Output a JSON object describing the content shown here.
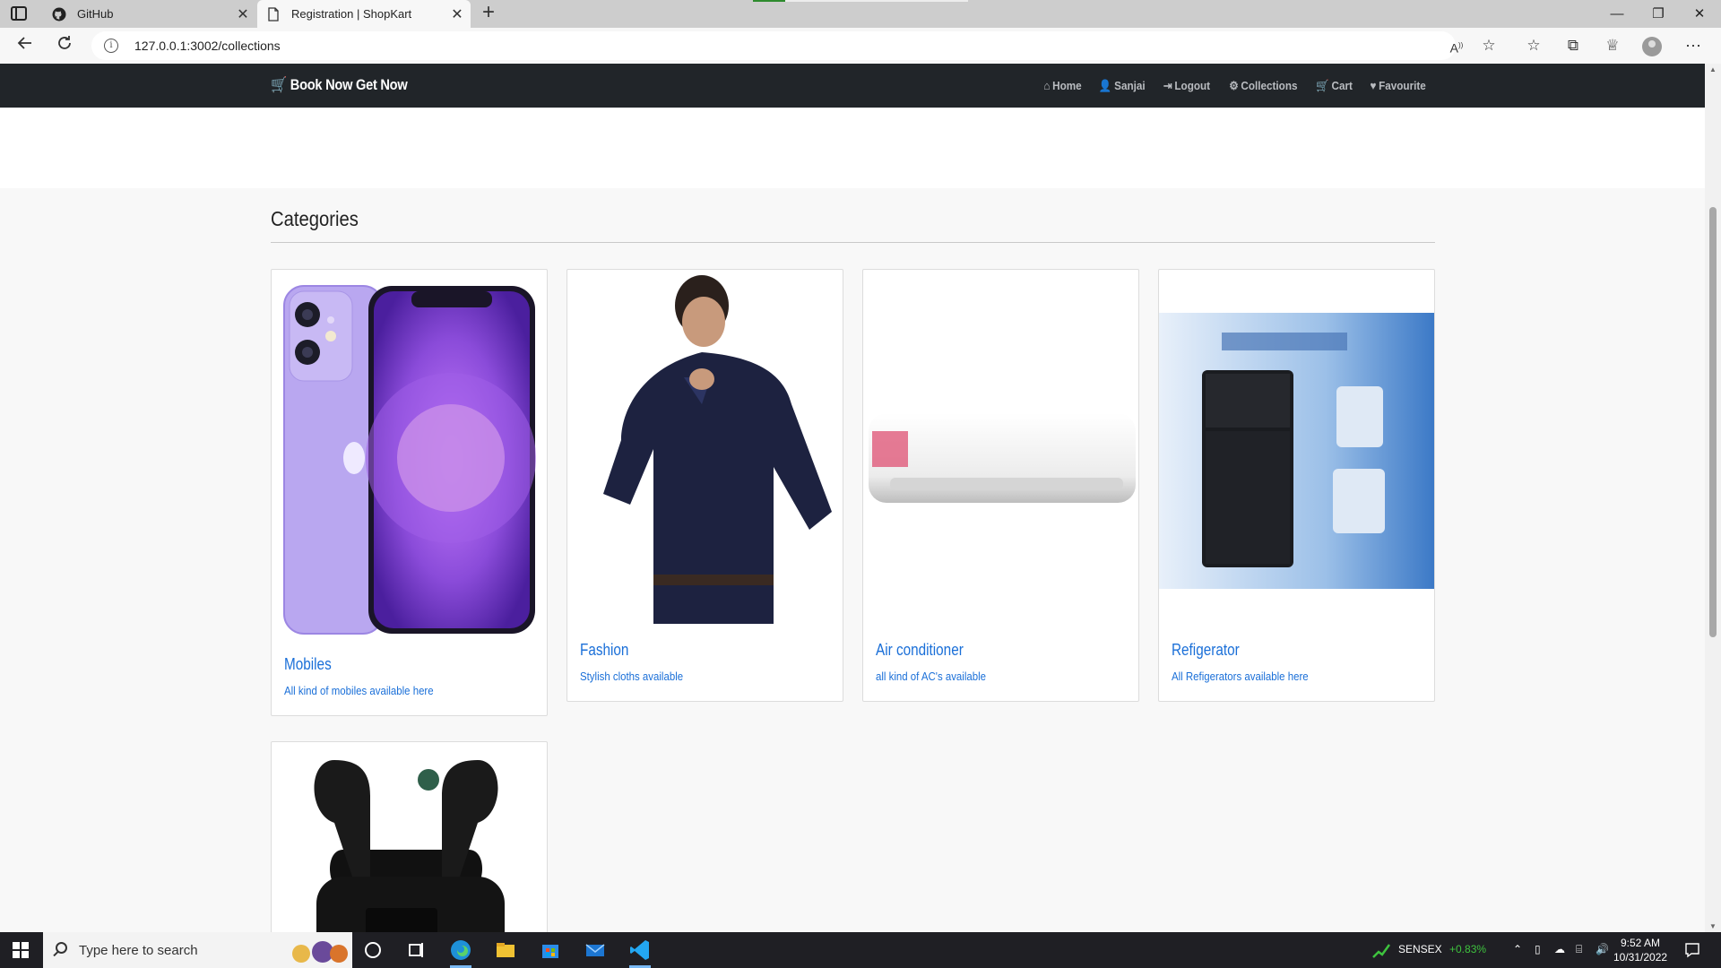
{
  "browser": {
    "tabs": [
      {
        "label": "GitHub",
        "close": "✕"
      },
      {
        "label": "Registration | ShopKart",
        "close": "✕"
      }
    ],
    "new_tab": "+",
    "url": "127.0.0.1:3002/collections",
    "window_controls": [
      "—",
      "❐",
      "✕"
    ],
    "load_progress": 0.15
  },
  "site": {
    "brand": "Book Now Get Now",
    "nav": [
      {
        "icon": "⌂",
        "label": "Home"
      },
      {
        "icon": "👤",
        "label": "Sanjai"
      },
      {
        "icon": "⇥",
        "label": "Logout"
      },
      {
        "icon": "⚙",
        "label": "Collections"
      },
      {
        "icon": "🛒",
        "label": "Cart"
      },
      {
        "icon": "♥",
        "label": "Favourite"
      }
    ],
    "section_title": "Categories",
    "categories": [
      {
        "title": "Mobiles",
        "description": "All kind of mobiles available here"
      },
      {
        "title": "Fashion",
        "description": "Stylish cloths available"
      },
      {
        "title": "Air conditioner",
        "description": "all kind of AC's available"
      },
      {
        "title": "Refigerator",
        "description": "All Refigerators available here"
      }
    ]
  },
  "taskbar": {
    "search_placeholder": "Type here to search",
    "sensex_label": "SENSEX",
    "sensex_change": "+0.83%",
    "time": "9:52 AM",
    "date": "10/31/2022"
  },
  "colors": {
    "navbar": "#212529",
    "link": "#1a6fd8",
    "sensex_up": "#3ec33e"
  }
}
